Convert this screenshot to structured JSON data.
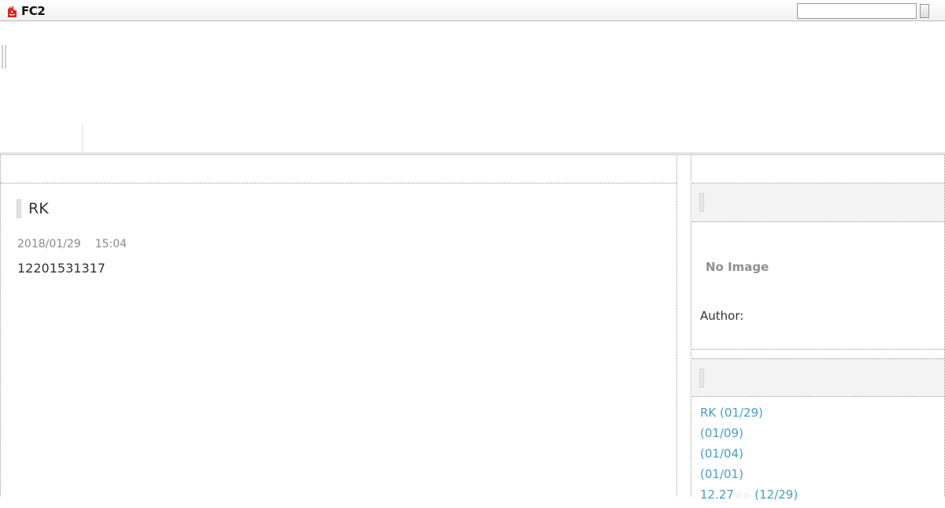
{
  "topbar": {
    "logo_text": "FC2",
    "search": {
      "value": "",
      "placeholder": ""
    },
    "search_button_label": ""
  },
  "entry": {
    "title": "RK",
    "date": "2018/01/29",
    "time": "15:04",
    "body": "12201531317"
  },
  "sidebar": {
    "profile": {
      "no_image": "No Image",
      "author_label": "Author:"
    },
    "recent_entries": [
      {
        "title": "RK",
        "date": "(01/29)"
      },
      {
        "title": "",
        "date": "(01/09)"
      },
      {
        "title": "",
        "date": "(01/04)"
      },
      {
        "title": "",
        "date": "(01/01)"
      },
      {
        "title": "12.27",
        "stars": "☆☆",
        "date": "(12/29)"
      }
    ]
  },
  "colors": {
    "link": "#4aa0c4",
    "meta": "#8a8a8a",
    "text": "#333333",
    "plugin_header_bg": "#f3f3f3",
    "logo_red": "#d9241c"
  }
}
